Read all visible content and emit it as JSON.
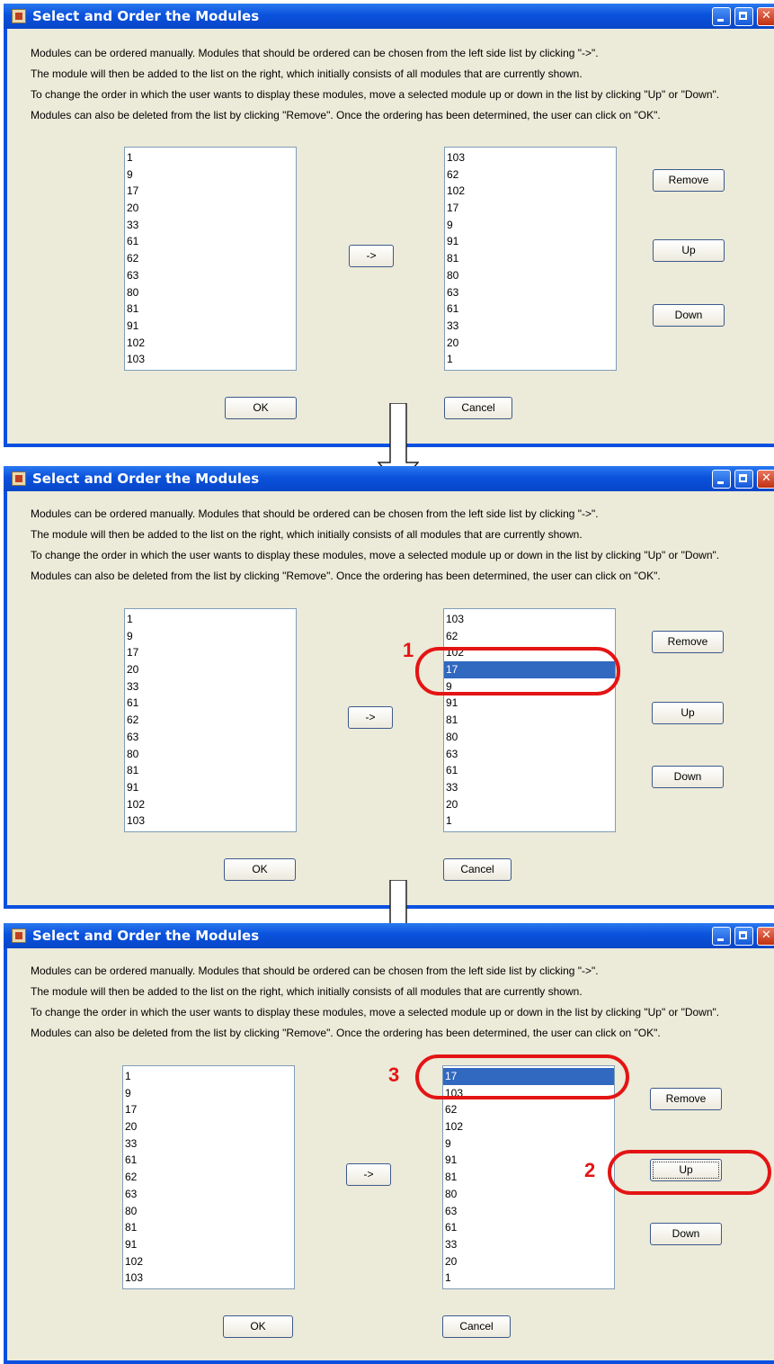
{
  "dialog": {
    "title": "Select and Order the Modules",
    "paragraphs": [
      "Modules can be ordered manually. Modules that should be ordered can be chosen from the left side list by clicking \"->\".",
      "The module will then be added to the list on the right, which initially consists of all modules that are currently shown.",
      "To change the order in which the user wants to display these modules, move a selected module up or down in the list by clicking \"Up\" or \"Down\".",
      "Modules can also be deleted from the list by clicking \"Remove\". Once the ordering has been determined, the user can click on \"OK\"."
    ],
    "add_label": "->",
    "remove_label": "Remove",
    "up_label": "Up",
    "down_label": "Down",
    "ok_label": "OK",
    "cancel_label": "Cancel"
  },
  "left_list": [
    "1",
    "9",
    "17",
    "20",
    "33",
    "61",
    "62",
    "63",
    "80",
    "81",
    "91",
    "102",
    "103"
  ],
  "steps": [
    {
      "right_list": [
        "103",
        "62",
        "102",
        "17",
        "9",
        "91",
        "81",
        "80",
        "63",
        "61",
        "33",
        "20",
        "1"
      ],
      "selected": null
    },
    {
      "right_list": [
        "103",
        "62",
        "102",
        "17",
        "9",
        "91",
        "81",
        "80",
        "63",
        "61",
        "33",
        "20",
        "1"
      ],
      "selected": "17"
    },
    {
      "right_list": [
        "17",
        "103",
        "62",
        "102",
        "9",
        "91",
        "81",
        "80",
        "63",
        "61",
        "33",
        "20",
        "1"
      ],
      "selected": "17"
    }
  ],
  "callouts": {
    "one": "1",
    "two": "2",
    "three": "3"
  },
  "colors": {
    "title_bar": "#0a52dc",
    "dialog_bg": "#ecead8",
    "selection": "#3168c0",
    "callout": "#e41414"
  }
}
